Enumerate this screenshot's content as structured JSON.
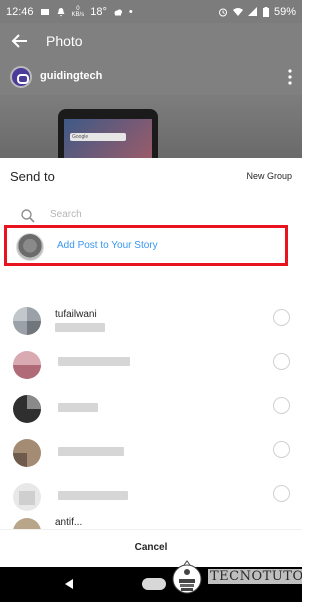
{
  "status_bar": {
    "time": "12:46",
    "speed_value": "0",
    "speed_unit": "KB/s",
    "temperature": "18°",
    "battery": "59%"
  },
  "appbar": {
    "title": "Photo"
  },
  "post": {
    "username": "guidingtech",
    "photo_search_text": "Google"
  },
  "sheet": {
    "title": "Send to",
    "new_group": "New Group",
    "search_placeholder": "Search",
    "story_label": "Add Post to Your Story",
    "contacts": [
      {
        "name": "tufailwani"
      },
      {
        "name": ""
      },
      {
        "name": ""
      },
      {
        "name": ""
      },
      {
        "name": ""
      },
      {
        "name": "antif..."
      }
    ],
    "cancel": "Cancel"
  },
  "watermark": {
    "text": "TECNOTUTO"
  },
  "colors": {
    "accent_blue": "#3897f0",
    "highlight_red": "#e8131e",
    "dim_gray": "#808080"
  }
}
